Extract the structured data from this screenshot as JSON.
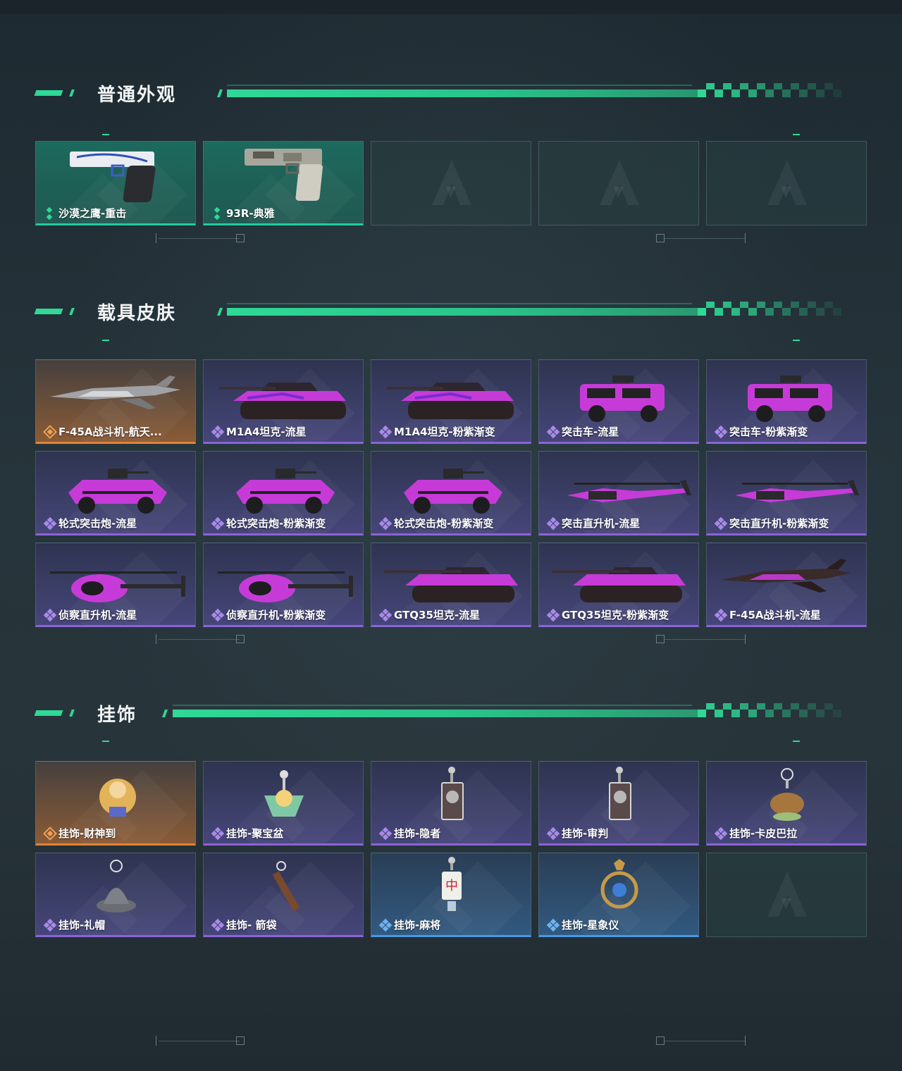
{
  "sections": [
    {
      "title": "普通外观",
      "items": [
        {
          "label": "沙漠之鹰-重击",
          "rarity": "green",
          "art": "pistol-white",
          "icon": "green-rank-icon"
        },
        {
          "label": "93R-典雅",
          "rarity": "green",
          "art": "pistol-camo",
          "icon": "green-rank-icon"
        },
        {
          "label": "",
          "rarity": "empty"
        },
        {
          "label": "",
          "rarity": "empty"
        },
        {
          "label": "",
          "rarity": "empty"
        }
      ]
    },
    {
      "title": "载具皮肤",
      "items": [
        {
          "label": "F-45A战斗机-航天...",
          "rarity": "orange",
          "art": "jet"
        },
        {
          "label": "M1A4坦克-流星",
          "rarity": "purple",
          "art": "tank"
        },
        {
          "label": "M1A4坦克-粉紫渐变",
          "rarity": "purple",
          "art": "tank"
        },
        {
          "label": "突击车-流星",
          "rarity": "purple",
          "art": "truck"
        },
        {
          "label": "突击车-粉紫渐变",
          "rarity": "purple",
          "art": "truck"
        },
        {
          "label": "轮式突击炮-流星",
          "rarity": "purple",
          "art": "armored-car"
        },
        {
          "label": "轮式突击炮-粉紫渐变",
          "rarity": "purple",
          "art": "armored-car"
        },
        {
          "label": "轮式突击炮-粉紫渐变",
          "rarity": "purple",
          "art": "armored-car"
        },
        {
          "label": "突击直升机-流星",
          "rarity": "purple",
          "art": "attack-heli"
        },
        {
          "label": "突击直升机-粉紫渐变",
          "rarity": "purple",
          "art": "attack-heli"
        },
        {
          "label": "侦察直升机-流星",
          "rarity": "purple",
          "art": "scout-heli"
        },
        {
          "label": "侦察直升机-粉紫渐变",
          "rarity": "purple",
          "art": "scout-heli"
        },
        {
          "label": "GTQ35坦克-流星",
          "rarity": "purple",
          "art": "tank-long"
        },
        {
          "label": "GTQ35坦克-粉紫渐变",
          "rarity": "purple",
          "art": "tank-long"
        },
        {
          "label": "F-45A战斗机-流星",
          "rarity": "purple",
          "art": "jet"
        }
      ]
    },
    {
      "title": "挂饰",
      "items": [
        {
          "label": "挂饰-财神到",
          "rarity": "orange",
          "art": "charm-god"
        },
        {
          "label": "挂饰-聚宝盆",
          "rarity": "purple",
          "art": "charm-bowl"
        },
        {
          "label": "挂饰-隐者",
          "rarity": "purple",
          "art": "charm-card"
        },
        {
          "label": "挂饰-审判",
          "rarity": "purple",
          "art": "charm-card"
        },
        {
          "label": "挂饰-卡皮巴拉",
          "rarity": "purple",
          "art": "charm-capybara"
        },
        {
          "label": "挂饰-礼帽",
          "rarity": "purple",
          "art": "charm-hat"
        },
        {
          "label": "挂饰- 箭袋",
          "rarity": "purple",
          "art": "charm-quiver"
        },
        {
          "label": "挂饰-麻将",
          "rarity": "blue",
          "art": "charm-mahjong"
        },
        {
          "label": "挂饰-星象仪",
          "rarity": "blue",
          "art": "charm-astrolabe"
        },
        {
          "label": "",
          "rarity": "empty"
        }
      ]
    }
  ],
  "colors": {
    "accent": "#2fd896",
    "green": "#25c9a1",
    "purple": "#8b63d8",
    "orange": "#e0833a",
    "blue": "#4a97e6"
  }
}
